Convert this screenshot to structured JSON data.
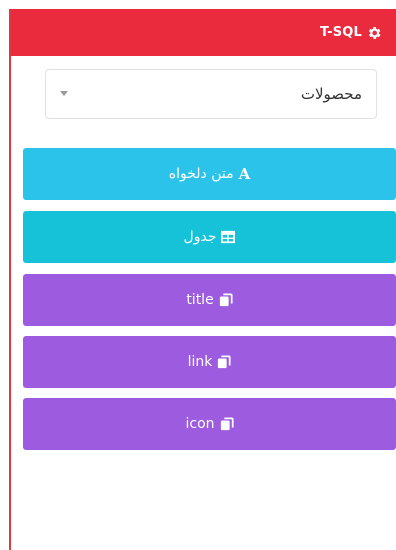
{
  "header": {
    "title": "T-SQL",
    "icon": "gear-icon",
    "color": "#ea2b3d"
  },
  "select": {
    "value": "محصولات"
  },
  "buttons": [
    {
      "label": "متن دلخواه",
      "icon": "font-icon",
      "color": "#2cc3eb"
    },
    {
      "label": "جدول",
      "icon": "table-icon",
      "color": "#16c2d8"
    },
    {
      "label": "title",
      "icon": "copy-icon",
      "color": "#9d5be0"
    },
    {
      "label": "link",
      "icon": "copy-icon",
      "color": "#9d5be0"
    },
    {
      "label": "icon",
      "icon": "copy-icon",
      "color": "#9d5be0"
    }
  ]
}
